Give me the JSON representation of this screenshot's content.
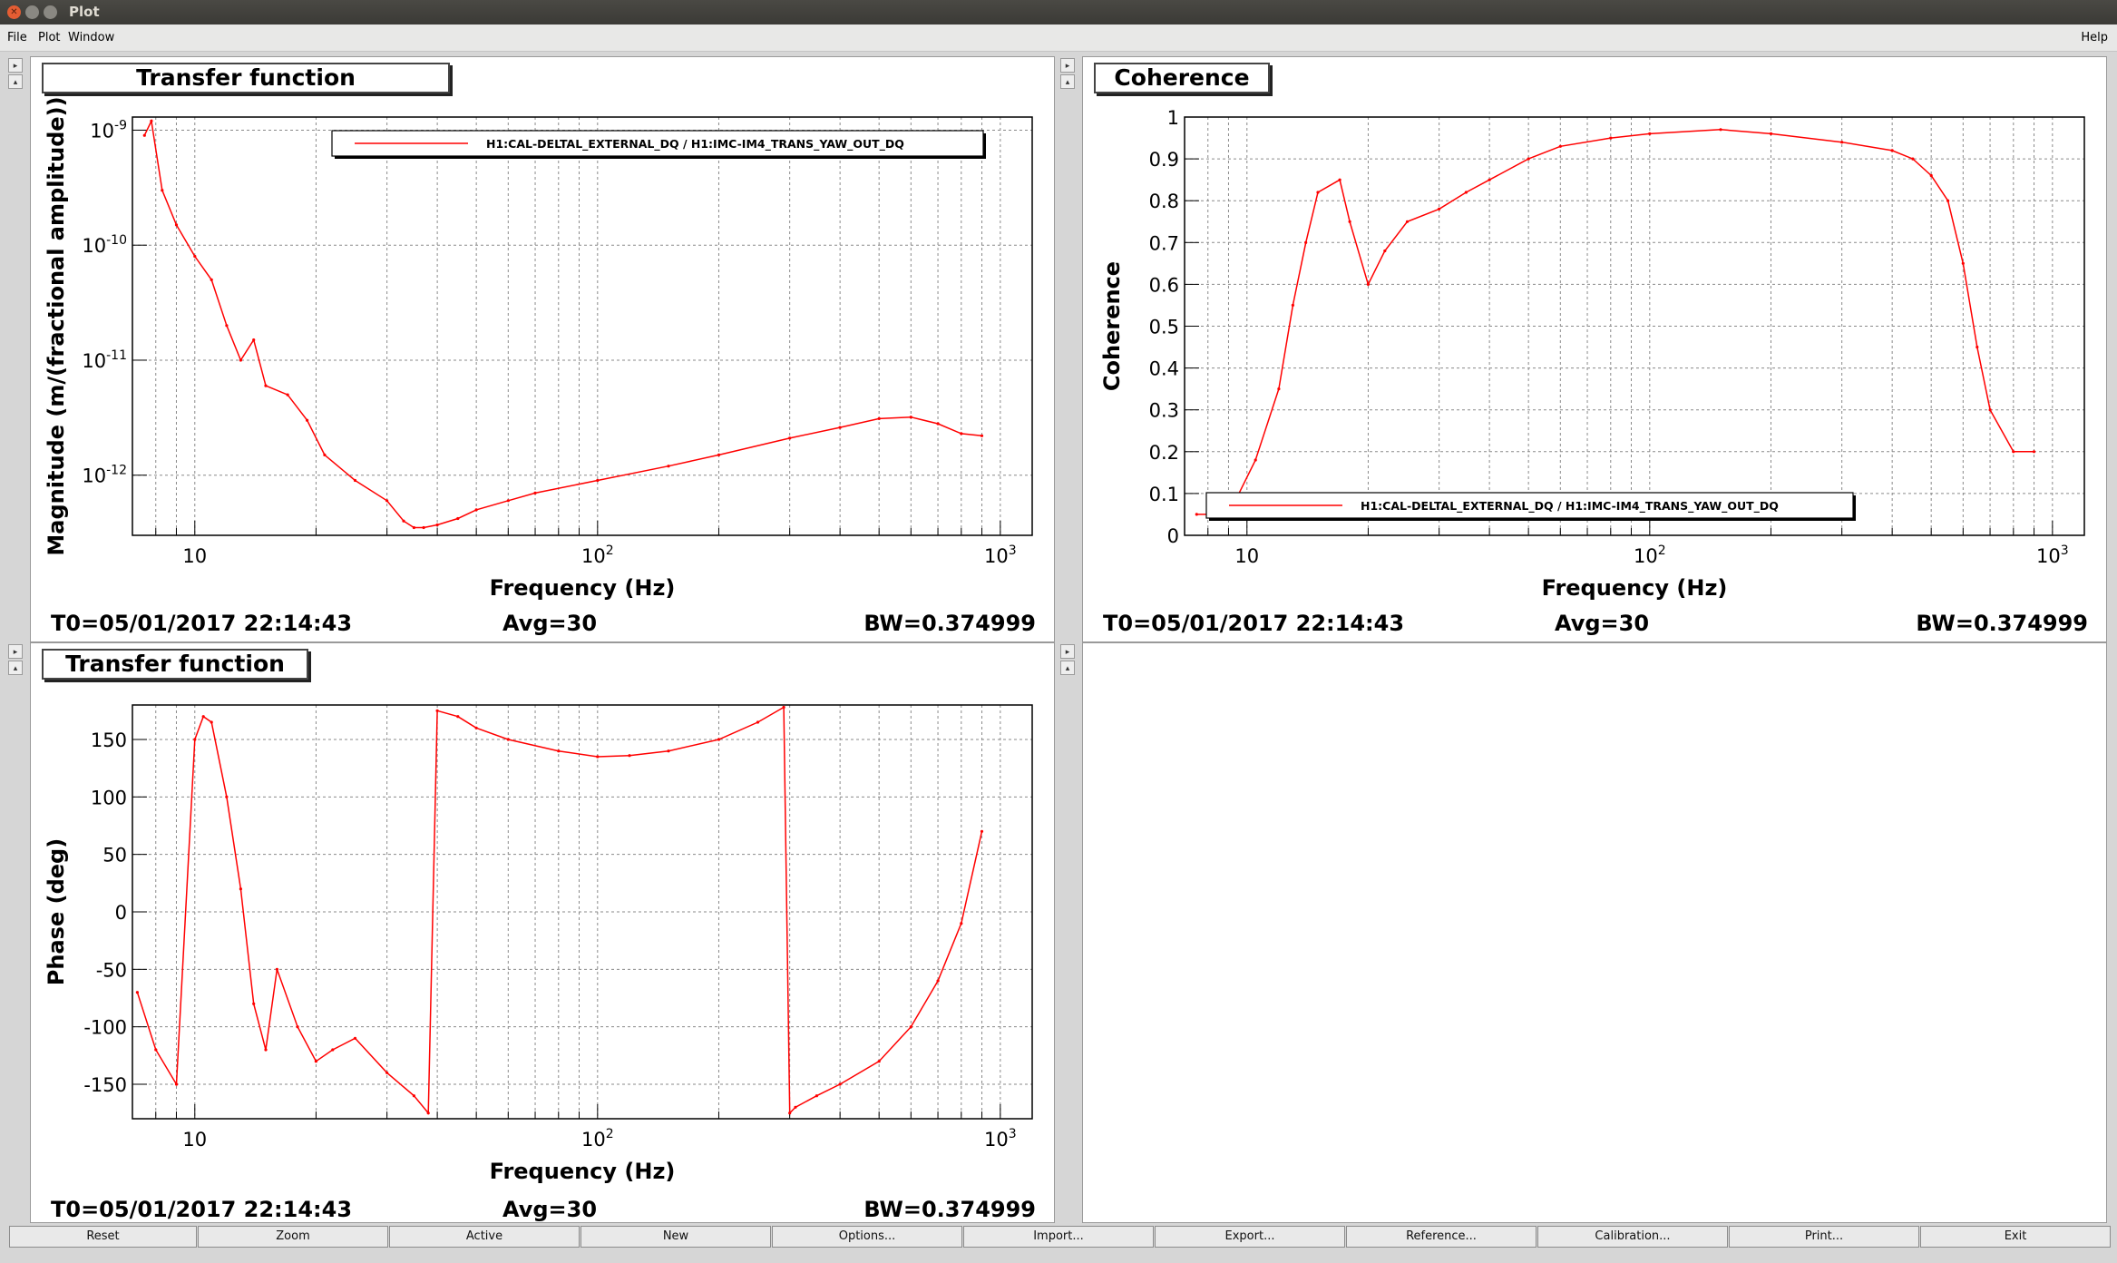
{
  "window": {
    "title": "Plot"
  },
  "menu": {
    "items": [
      "File",
      "Plot",
      "Window"
    ],
    "help": "Help"
  },
  "panels": [
    {
      "title": "Transfer function",
      "ylabel": "Magnitude (m/(fractional amplitude))",
      "xlabel": "Frequency (Hz)",
      "legend": "H1:CAL-DELTAL_EXTERNAL_DQ / H1:IMC-IM4_TRANS_YAW_OUT_DQ",
      "footer": {
        "t0": "T0=05/01/2017 22:14:43",
        "avg": "Avg=30",
        "bw": "BW=0.374999"
      }
    },
    {
      "title": "Coherence",
      "ylabel": "Coherence",
      "xlabel": "Frequency (Hz)",
      "legend": "H1:CAL-DELTAL_EXTERNAL_DQ / H1:IMC-IM4_TRANS_YAW_OUT_DQ",
      "footer": {
        "t0": "T0=05/01/2017 22:14:43",
        "avg": "Avg=30",
        "bw": "BW=0.374999"
      }
    },
    {
      "title": "Transfer function",
      "ylabel": "Phase (deg)",
      "xlabel": "Frequency (Hz)",
      "footer": {
        "t0": "T0=05/01/2017 22:14:43",
        "avg": "Avg=30",
        "bw": "BW=0.374999"
      }
    }
  ],
  "buttons": [
    "Reset",
    "Zoom",
    "Active",
    "New",
    "Options...",
    "Import...",
    "Export...",
    "Reference...",
    "Calibration...",
    "Print...",
    "Exit"
  ],
  "chart_data": [
    {
      "type": "line",
      "title": "Transfer function",
      "xlabel": "Frequency (Hz)",
      "ylabel": "Magnitude (m/(fractional amplitude))",
      "xscale": "log",
      "yscale": "log",
      "xlim": [
        7,
        1200
      ],
      "ylim": [
        3e-13,
        1.3e-09
      ],
      "x_ticklabels": [
        "10",
        "10^2",
        "10^3"
      ],
      "y_ticklabels": [
        "10^-9",
        "10^-10",
        "10^-11",
        "10^-12"
      ],
      "grid": true,
      "legend_position": "top-right",
      "series": [
        {
          "name": "H1:CAL-DELTAL_EXTERNAL_DQ / H1:IMC-IM4_TRANS_YAW_OUT_DQ",
          "color": "#ff0000",
          "x": [
            7.5,
            7.8,
            8.3,
            9,
            10,
            11,
            12,
            13,
            14,
            15,
            17,
            19,
            21,
            25,
            30,
            33,
            35,
            37,
            40,
            45,
            50,
            60,
            70,
            100,
            150,
            200,
            300,
            400,
            500,
            600,
            700,
            800,
            900
          ],
          "y": [
            9e-10,
            1.2e-09,
            3e-10,
            1.5e-10,
            8e-11,
            5e-11,
            2e-11,
            1e-11,
            1.5e-11,
            6e-12,
            5e-12,
            3e-12,
            1.5e-12,
            9e-13,
            6e-13,
            4e-13,
            3.5e-13,
            3.5e-13,
            3.7e-13,
            4.2e-13,
            5e-13,
            6e-13,
            7e-13,
            9e-13,
            1.2e-12,
            1.5e-12,
            2.1e-12,
            2.6e-12,
            3.1e-12,
            3.2e-12,
            2.8e-12,
            2.3e-12,
            2.2e-12
          ]
        }
      ]
    },
    {
      "type": "line",
      "title": "Coherence",
      "xlabel": "Frequency (Hz)",
      "ylabel": "Coherence",
      "xscale": "log",
      "xlim": [
        7,
        1200
      ],
      "ylim": [
        0,
        1
      ],
      "x_ticklabels": [
        "10",
        "10^2",
        "10^3"
      ],
      "y_ticklabels": [
        "0",
        "0.1",
        "0.2",
        "0.3",
        "0.4",
        "0.5",
        "0.6",
        "0.7",
        "0.8",
        "0.9",
        "1"
      ],
      "grid": true,
      "legend_position": "bottom",
      "series": [
        {
          "name": "H1:CAL-DELTAL_EXTERNAL_DQ / H1:IMC-IM4_TRANS_YAW_OUT_DQ",
          "color": "#ff0000",
          "x": [
            7.5,
            9,
            10.5,
            12,
            13,
            14,
            15,
            17,
            18,
            20,
            22,
            25,
            30,
            35,
            40,
            50,
            60,
            80,
            100,
            150,
            200,
            300,
            400,
            450,
            500,
            550,
            600,
            650,
            700,
            800,
            900
          ],
          "y": [
            0.05,
            0.05,
            0.18,
            0.35,
            0.55,
            0.7,
            0.82,
            0.85,
            0.75,
            0.6,
            0.68,
            0.75,
            0.78,
            0.82,
            0.85,
            0.9,
            0.93,
            0.95,
            0.96,
            0.97,
            0.96,
            0.94,
            0.92,
            0.9,
            0.86,
            0.8,
            0.65,
            0.45,
            0.3,
            0.2,
            0.2
          ]
        }
      ]
    },
    {
      "type": "line",
      "title": "Transfer function",
      "xlabel": "Frequency (Hz)",
      "ylabel": "Phase (deg)",
      "xscale": "log",
      "xlim": [
        7,
        1200
      ],
      "ylim": [
        -180,
        180
      ],
      "x_ticklabels": [
        "10",
        "10^2",
        "10^3"
      ],
      "y_ticklabels": [
        "150",
        "100",
        "50",
        "0",
        "-50",
        "-100",
        "-150"
      ],
      "grid": true,
      "series": [
        {
          "name": "",
          "color": "#ff0000",
          "x": [
            7.2,
            8,
            9,
            10,
            10.5,
            11,
            12,
            13,
            14,
            15,
            16,
            18,
            20,
            22,
            25,
            30,
            35,
            38,
            40,
            45,
            50,
            60,
            80,
            100,
            120,
            150,
            200,
            250,
            290,
            300,
            310,
            350,
            400,
            500,
            600,
            700,
            800,
            900
          ],
          "y": [
            -70,
            -120,
            -150,
            150,
            170,
            165,
            100,
            20,
            -80,
            -120,
            -50,
            -100,
            -130,
            -120,
            -110,
            -140,
            -160,
            -175,
            175,
            170,
            160,
            150,
            140,
            135,
            136,
            140,
            150,
            165,
            178,
            -175,
            -170,
            -160,
            -150,
            -130,
            -100,
            -60,
            -10,
            70
          ]
        }
      ]
    }
  ]
}
